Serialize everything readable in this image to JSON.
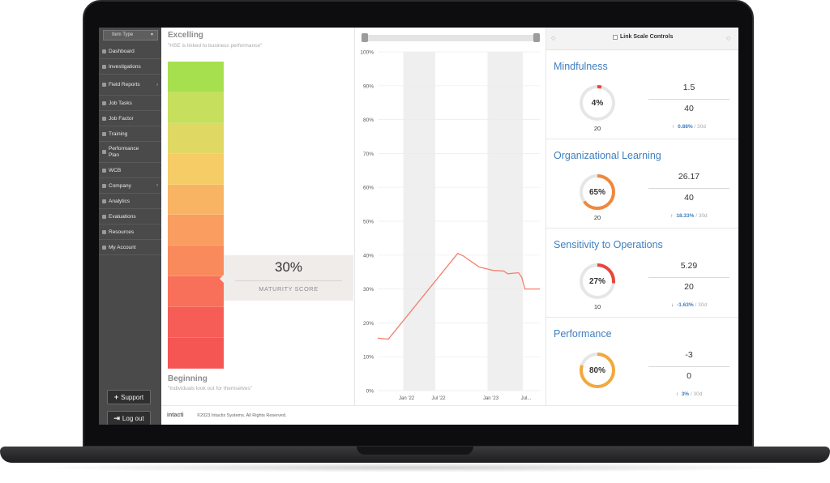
{
  "sidebar": {
    "item_type": "Item Type",
    "items": [
      {
        "label": "Dashboard",
        "arrow": false
      },
      {
        "label": "Investigations",
        "arrow": false
      },
      {
        "label": "Field Reports",
        "arrow": true
      },
      {
        "label": "Job Tasks",
        "arrow": false
      },
      {
        "label": "Job Factor",
        "arrow": false
      },
      {
        "label": "Training",
        "arrow": false
      },
      {
        "label": "Performance Plan",
        "arrow": false
      },
      {
        "label": "WCB",
        "arrow": false
      },
      {
        "label": "Company",
        "arrow": true
      },
      {
        "label": "Analytics",
        "arrow": false
      },
      {
        "label": "Evaluations",
        "arrow": false
      },
      {
        "label": "Resources",
        "arrow": false
      },
      {
        "label": "My Account",
        "arrow": false
      }
    ],
    "support_label": "Support",
    "logout_label": "Log out"
  },
  "maturity": {
    "top_title": "Excelling",
    "top_quote": "\"HSE is linked to business performance\"",
    "bottom_title": "Beginning",
    "bottom_quote": "\"Individuals look out for themselves\"",
    "score": "30%",
    "score_label": "MATURITY SCORE",
    "score_fraction": 0.3,
    "bar_colors": [
      "#a6e04f",
      "#c6df5c",
      "#dfd963",
      "#f6cc66",
      "#f9b463",
      "#fa9d60",
      "#f98a5c",
      "#f8705a",
      "#f65d56",
      "#f55553"
    ]
  },
  "chart_data": {
    "type": "line",
    "x_tick_labels": [
      "Jan '22",
      "Jul '22",
      "Jan '23",
      "Jul..."
    ],
    "y_tick_labels": [
      "0%",
      "10%",
      "20%",
      "30%",
      "40%",
      "50%",
      "60%",
      "70%",
      "80%",
      "90%",
      "100%"
    ],
    "ylim": [
      0,
      100
    ],
    "xlim": [
      0,
      1.52
    ],
    "series": [
      {
        "color": "#f27e6f",
        "x": [
          0.0,
          0.1,
          0.75,
          0.8,
          0.95,
          1.08,
          1.18,
          1.22,
          1.32,
          1.35,
          1.38,
          1.44,
          1.52
        ],
        "y": [
          15.5,
          15.2,
          40.5,
          39.8,
          36.5,
          35.5,
          35.3,
          34.5,
          34.8,
          33.5,
          30.0,
          30.0,
          30.0
        ]
      }
    ],
    "shaded_bands_x": [
      [
        0.24,
        0.54
      ],
      [
        1.03,
        1.36
      ]
    ],
    "x_tick_positions": [
      0.24,
      0.54,
      1.03,
      1.36
    ],
    "grid": true
  },
  "right_panel": {
    "link_label": "Link Scale Controls",
    "metrics": [
      {
        "title": "Mindfulness",
        "gauge": "4%",
        "gauge_value": 0.04,
        "gauge_color": "#e8463a",
        "below": "20",
        "value1": "1.5",
        "value2": "40",
        "delta_dir": "up",
        "delta_pct": "0.88%",
        "delta_period": "/ 30d"
      },
      {
        "title": "Organizational Learning",
        "gauge": "65%",
        "gauge_value": 0.65,
        "gauge_color": "#f0883c",
        "below": "20",
        "value1": "26.17",
        "value2": "40",
        "delta_dir": "up",
        "delta_pct": "18.33%",
        "delta_period": "/ 30d"
      },
      {
        "title": "Sensitivity to Operations",
        "gauge": "27%",
        "gauge_value": 0.27,
        "gauge_color": "#e8463a",
        "below": "10",
        "value1": "5.29",
        "value2": "20",
        "delta_dir": "down",
        "delta_pct": "-1.63%",
        "delta_period": "/ 30d"
      },
      {
        "title": "Performance",
        "gauge": "80%",
        "gauge_value": 0.8,
        "gauge_color": "#f2a93b",
        "below": "",
        "value1": "-3",
        "value2": "0",
        "delta_dir": "up",
        "delta_pct": "3%",
        "delta_period": "/ 30d"
      }
    ]
  },
  "footer": {
    "logo": "intacti",
    "copyright": "©2023 Intactix Systems. All Rights Reserved."
  }
}
